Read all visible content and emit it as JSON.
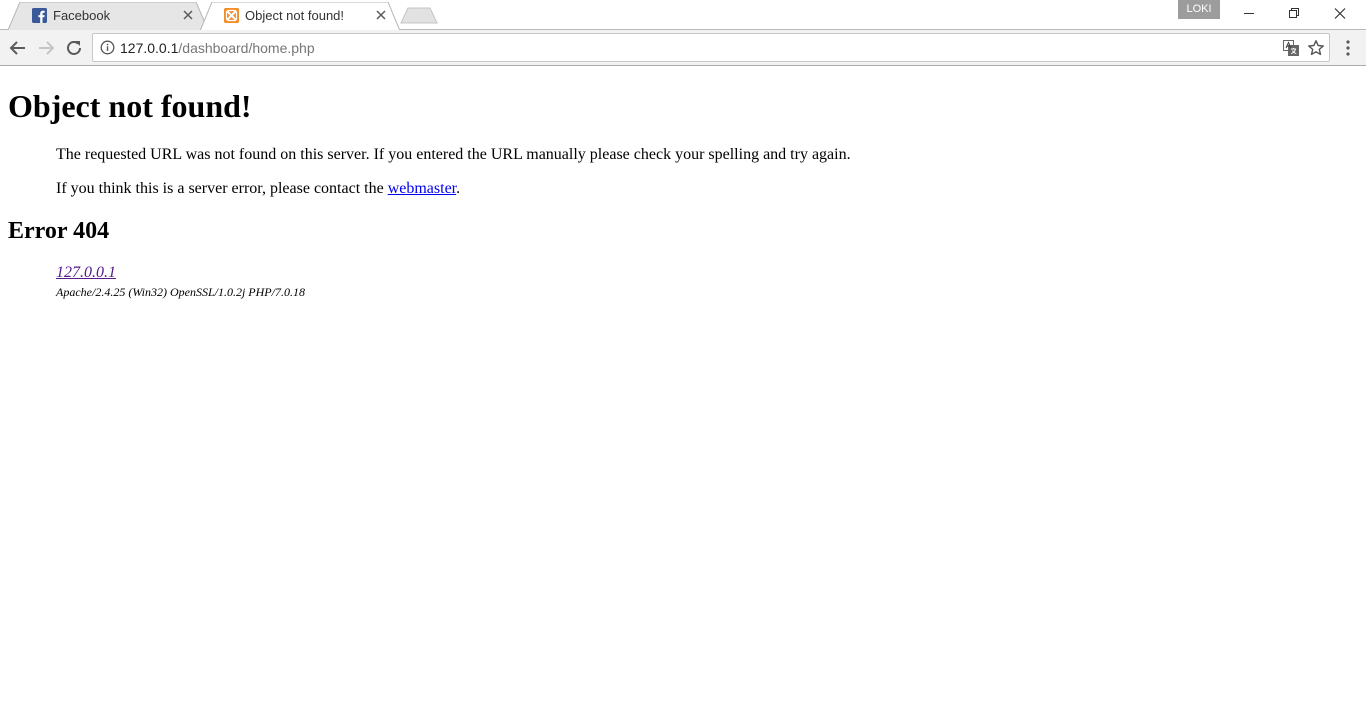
{
  "browser": {
    "tabs": [
      {
        "title": "Facebook",
        "favicon": "facebook-icon",
        "active": false
      },
      {
        "title": "Object not found!",
        "favicon": "xampp-icon",
        "active": true
      }
    ],
    "profile_name": "LOKI",
    "address_bar": {
      "host": "127.0.0.1",
      "path": "/dashboard/home.php"
    },
    "icons": {
      "back": "back-arrow-icon",
      "forward": "forward-arrow-icon",
      "reload": "reload-icon",
      "info": "info-icon",
      "translate": "translate-icon",
      "bookmark": "star-icon",
      "menu": "kebab-menu-icon"
    },
    "colors": {
      "facebook_brand": "#3b5998",
      "xampp_brand": "#f28e2b",
      "link": "#0000ee",
      "visited_link": "#551a8b"
    }
  },
  "page": {
    "heading": "Object not found!",
    "paragraph1": "The requested URL was not found on this server. If you entered the URL manually please check your spelling and try again.",
    "paragraph2_before": "If you think this is a server error, please contact the ",
    "paragraph2_link": "webmaster",
    "paragraph2_after": ".",
    "error_heading": "Error 404",
    "address_link": "127.0.0.1",
    "server_signature": "Apache/2.4.25 (Win32) OpenSSL/1.0.2j PHP/7.0.18"
  }
}
